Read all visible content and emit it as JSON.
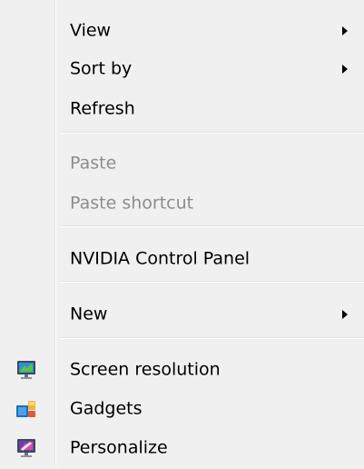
{
  "context_menu": {
    "items": [
      {
        "label": "View",
        "submenu": true,
        "enabled": true
      },
      {
        "label": "Sort by",
        "submenu": true,
        "enabled": true
      },
      {
        "label": "Refresh",
        "submenu": false,
        "enabled": true
      },
      {
        "label": "Paste",
        "submenu": false,
        "enabled": false
      },
      {
        "label": "Paste shortcut",
        "submenu": false,
        "enabled": false
      },
      {
        "label": "NVIDIA Control Panel",
        "submenu": false,
        "enabled": true
      },
      {
        "label": "New",
        "submenu": true,
        "enabled": true
      },
      {
        "label": "Screen resolution",
        "submenu": false,
        "enabled": true,
        "icon": "monitor-icon"
      },
      {
        "label": "Gadgets",
        "submenu": false,
        "enabled": true,
        "icon": "gadgets-icon"
      },
      {
        "label": "Personalize",
        "submenu": false,
        "enabled": true,
        "icon": "personalize-icon"
      }
    ]
  },
  "colors": {
    "menu_background": "#f0f0f0",
    "disabled_text": "#8d8d8d",
    "separator": "#e2e3e3"
  }
}
